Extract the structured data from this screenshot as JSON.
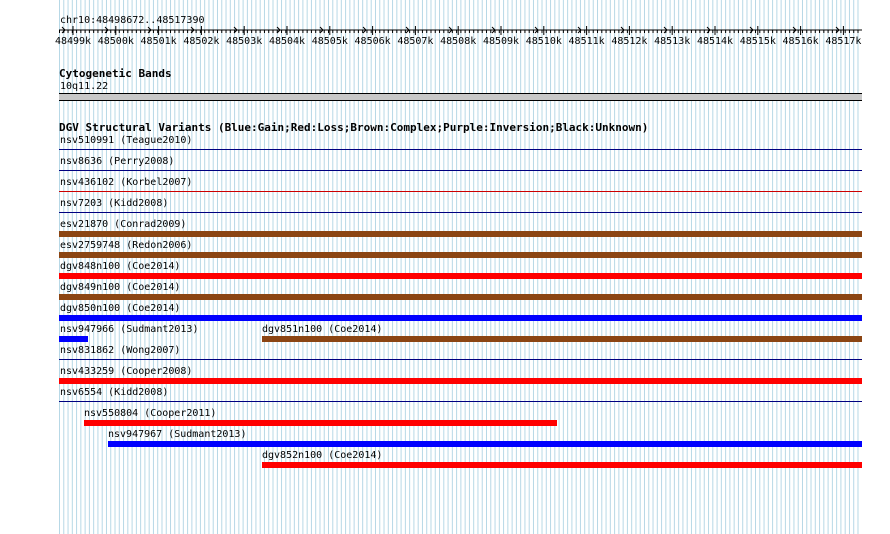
{
  "location": "chr10:48498672..48517390",
  "ruler_ticks": [
    "48499k",
    "48500k",
    "48501k",
    "48502k",
    "48503k",
    "48504k",
    "48505k",
    "48506k",
    "48507k",
    "48508k",
    "48509k",
    "48510k",
    "48511k",
    "48512k",
    "48513k",
    "48514k",
    "48515k",
    "48516k",
    "48517k"
  ],
  "cytoband": {
    "title": "Cytogenetic Bands",
    "band_label": "10q11.22"
  },
  "dgv": {
    "title": "DGV Structural Variants (Blue:Gain;Red:Loss;Brown:Complex;Purple:Inversion;Black:Unknown)",
    "rows": [
      {
        "features": [
          {
            "label": "nsv510991 (Teague2010)"
          }
        ]
      },
      {
        "features": [
          {
            "label": "nsv8636 (Perry2008)"
          }
        ]
      },
      {
        "features": [
          {
            "label": "nsv436102 (Korbel2007)"
          }
        ]
      },
      {
        "features": [
          {
            "label": "nsv7203 (Kidd2008)"
          }
        ]
      },
      {
        "features": [
          {
            "label": "esv21870 (Conrad2009)",
            "color": "#8b4513"
          }
        ]
      },
      {
        "features": [
          {
            "label": "esv2759748 (Redon2006)",
            "color": "#8b4513"
          }
        ]
      },
      {
        "features": [
          {
            "label": "dgv848n100 (Coe2014)",
            "color": "#ff0000"
          }
        ]
      },
      {
        "features": [
          {
            "label": "dgv849n100 (Coe2014)",
            "color": "#8b4513"
          }
        ]
      },
      {
        "features": [
          {
            "label": "dgv850n100 (Coe2014)",
            "color": "#0000ff"
          }
        ]
      },
      {
        "features": [
          {
            "label": "nsv947966 (Sudmant2013)",
            "color": "#0000ff"
          },
          {
            "label": "dgv851n100 (Coe2014)",
            "color": "#8b4513"
          }
        ]
      },
      {
        "features": [
          {
            "label": "nsv831862 (Wong2007)"
          }
        ]
      },
      {
        "features": [
          {
            "label": "nsv433259 (Cooper2008)",
            "color": "#ff0000"
          }
        ]
      },
      {
        "features": [
          {
            "label": "nsv6554 (Kidd2008)"
          }
        ]
      },
      {
        "features": [
          {
            "label": "nsv550804 (Cooper2011)",
            "color": "#ff0000"
          }
        ]
      },
      {
        "features": [
          {
            "label": "nsv947967 (Sudmant2013)",
            "color": "#0000ff"
          }
        ]
      },
      {
        "features": [
          {
            "label": "dgv852n100 (Coe2014)",
            "color": "#ff0000"
          }
        ]
      }
    ]
  },
  "colors": {
    "gain": "#0000ff",
    "loss": "#ff0000",
    "complex": "#8b4513",
    "grid": "#b7d8e6",
    "separator_red": "#cc0000",
    "separator_navy": "#000080"
  }
}
